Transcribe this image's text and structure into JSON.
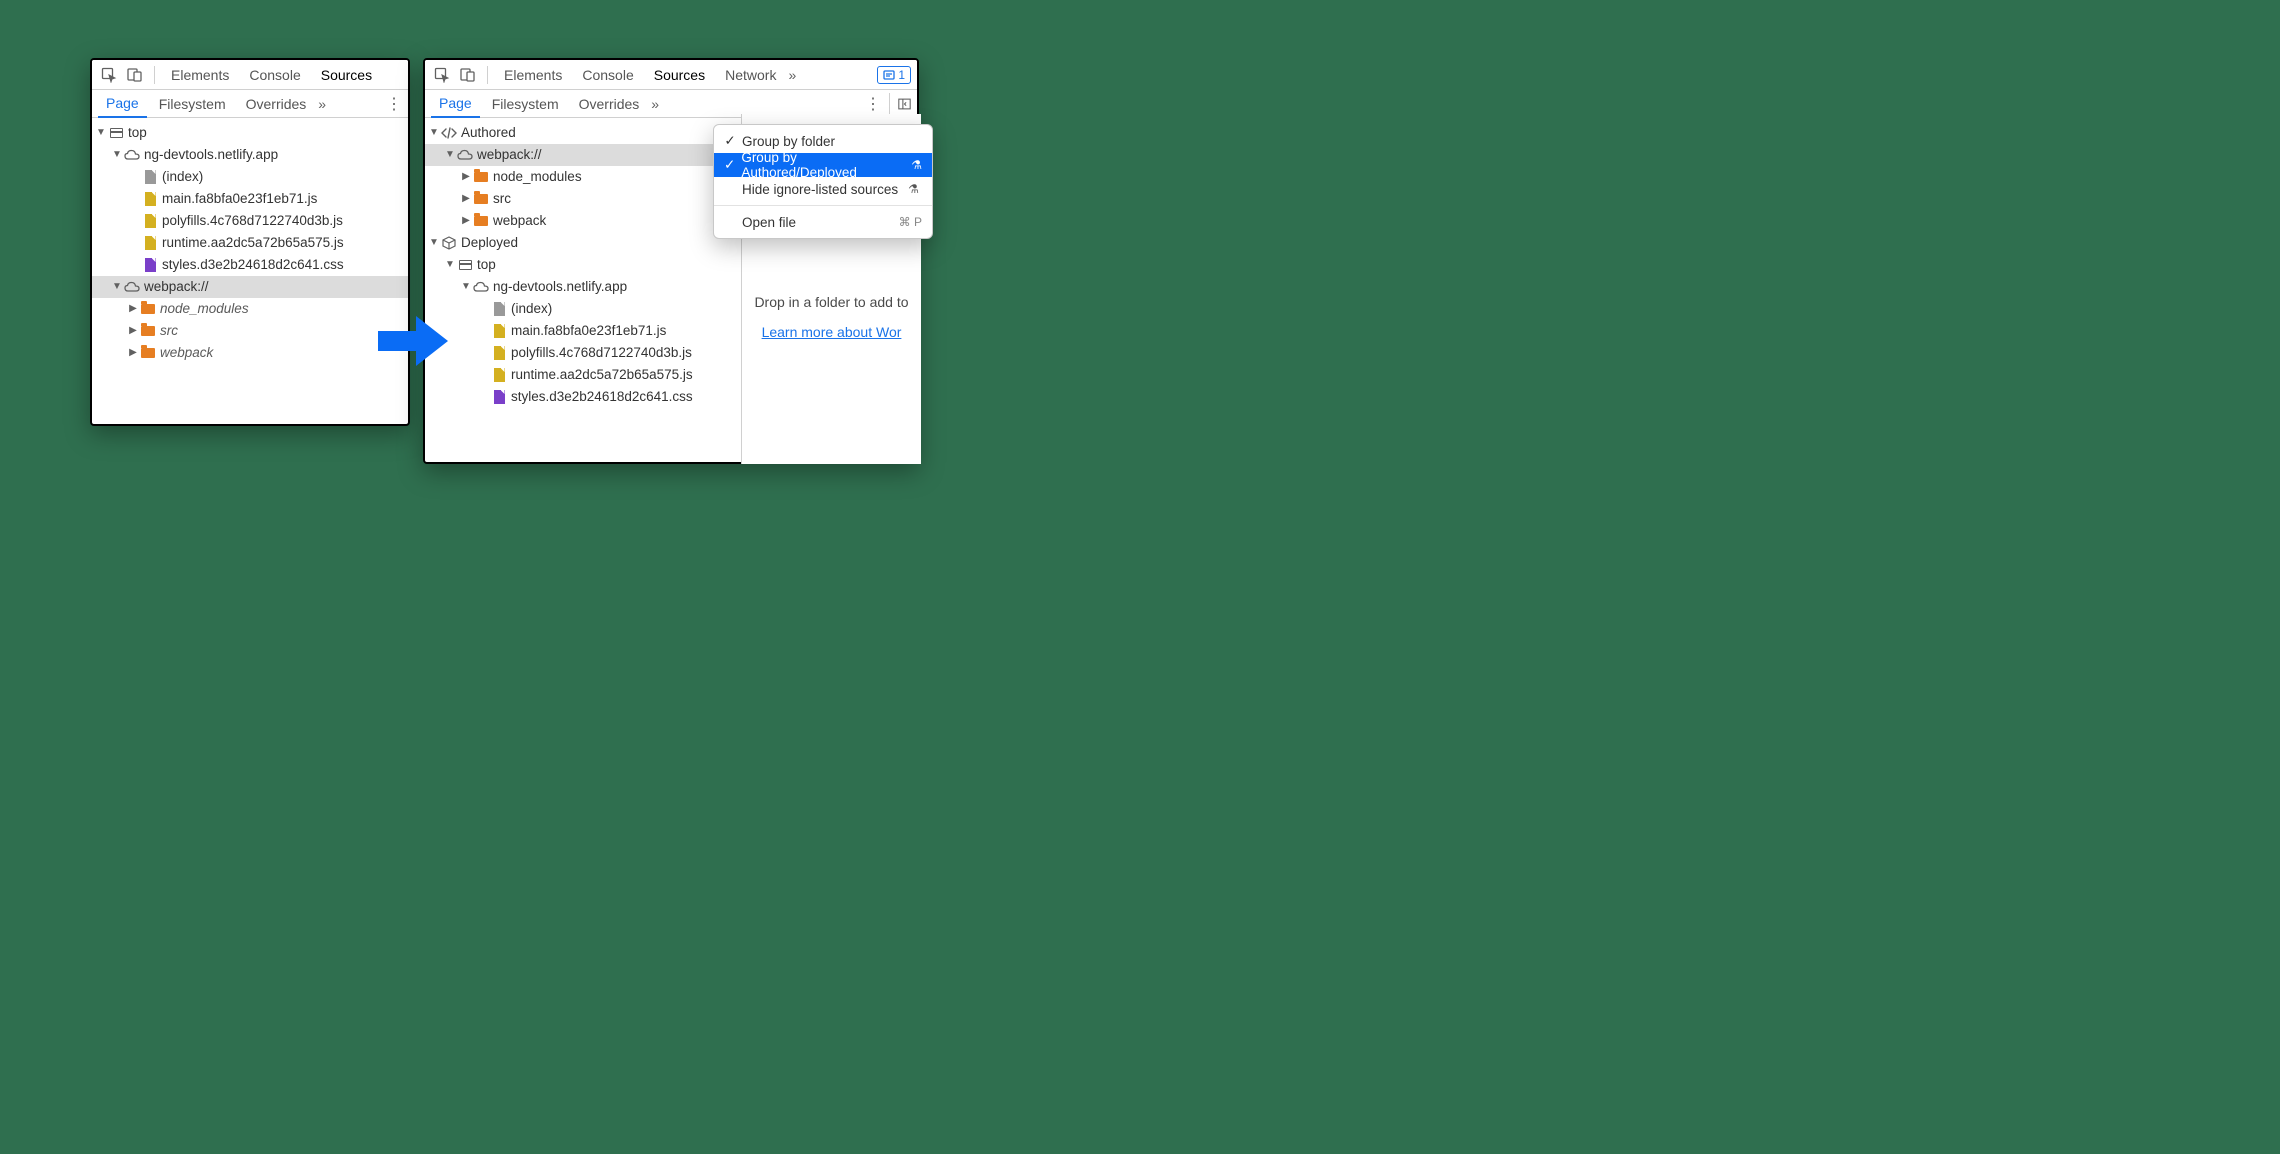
{
  "tabs": {
    "elements": "Elements",
    "console": "Console",
    "sources": "Sources",
    "network": "Network"
  },
  "subtabs": {
    "page": "Page",
    "filesystem": "Filesystem",
    "overrides": "Overrides"
  },
  "issues_count": "1",
  "left_tree": {
    "top": "top",
    "domain": "ng-devtools.netlify.app",
    "index": "(index)",
    "main_js": "main.fa8bfa0e23f1eb71.js",
    "polyfills_js": "polyfills.4c768d7122740d3b.js",
    "runtime_js": "runtime.aa2dc5a72b65a575.js",
    "styles_css": "styles.d3e2b24618d2c641.css",
    "webpack": "webpack://",
    "node_modules": "node_modules",
    "src": "src",
    "webpack_dir": "webpack"
  },
  "right_tree": {
    "authored": "Authored",
    "webpack": "webpack://",
    "node_modules": "node_modules",
    "src": "src",
    "webpack_dir": "webpack",
    "deployed": "Deployed",
    "top": "top",
    "domain": "ng-devtools.netlify.app",
    "index": "(index)",
    "main_js": "main.fa8bfa0e23f1eb71.js",
    "polyfills_js": "polyfills.4c768d7122740d3b.js",
    "runtime_js": "runtime.aa2dc5a72b65a575.js",
    "styles_css": "styles.d3e2b24618d2c641.css"
  },
  "menu": {
    "group_folder": "Group by folder",
    "group_authored": "Group by Authored/Deployed",
    "hide_ignore": "Hide ignore-listed sources",
    "open_file": "Open file",
    "open_file_shortcut": "⌘ P"
  },
  "hints": {
    "drop_folder": "Drop in a folder to add to",
    "learn_more": "Learn more about Wor"
  }
}
